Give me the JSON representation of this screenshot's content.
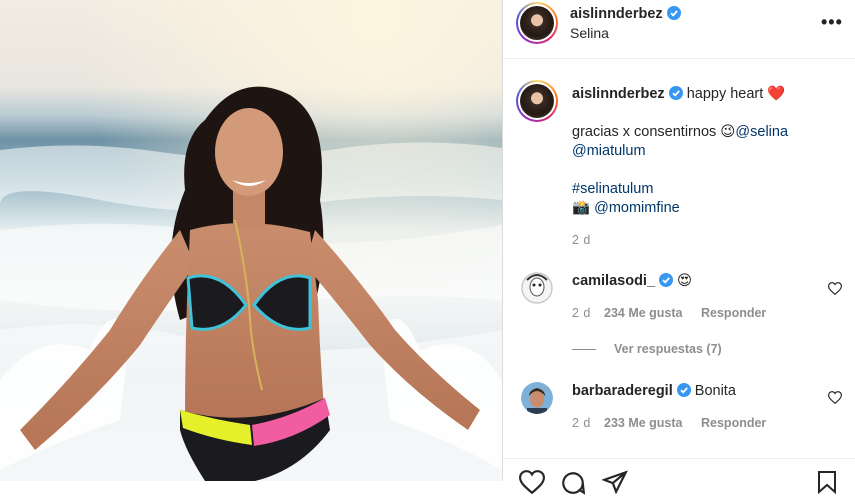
{
  "post": {
    "username": "aislinnderbez",
    "location": "Selina",
    "caption_title": "happy heart",
    "caption_emoji_heart": "❤️",
    "caption_line1_text": "gracias x consentirnos",
    "caption_line1_emoji": "😉",
    "caption_mention1": "@selina",
    "caption_mention2": "@miatulum",
    "hashtag": "#selinatulum",
    "camera_emoji": "📸",
    "photo_credit": "@momimfine",
    "time": "2 d"
  },
  "comments": [
    {
      "username": "camilasodi_",
      "text": "😍",
      "time": "2 d",
      "likes": "234 Me gusta",
      "reply": "Responder",
      "view_replies": "Ver respuestas (7)"
    },
    {
      "username": "barbaraderegil",
      "text": "Bonita",
      "time": "2 d",
      "likes": "233 Me gusta",
      "reply": "Responder"
    }
  ],
  "colors": {
    "verified": "#3897f0",
    "mention": "#00376b",
    "muted": "#8e8e8e"
  },
  "icons": [
    "more-icon",
    "verified-icon",
    "heart-icon",
    "comment-icon",
    "share-icon",
    "bookmark-icon"
  ]
}
